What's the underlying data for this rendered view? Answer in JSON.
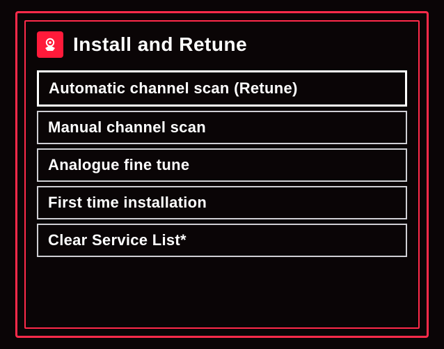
{
  "header": {
    "title": "Install and Retune"
  },
  "menu": {
    "items": [
      {
        "label": "Automatic channel scan (Retune)",
        "selected": true
      },
      {
        "label": "Manual channel scan",
        "selected": false
      },
      {
        "label": "Analogue fine tune",
        "selected": false
      },
      {
        "label": "First time installation",
        "selected": false
      },
      {
        "label": "Clear Service List*",
        "selected": false
      }
    ]
  }
}
